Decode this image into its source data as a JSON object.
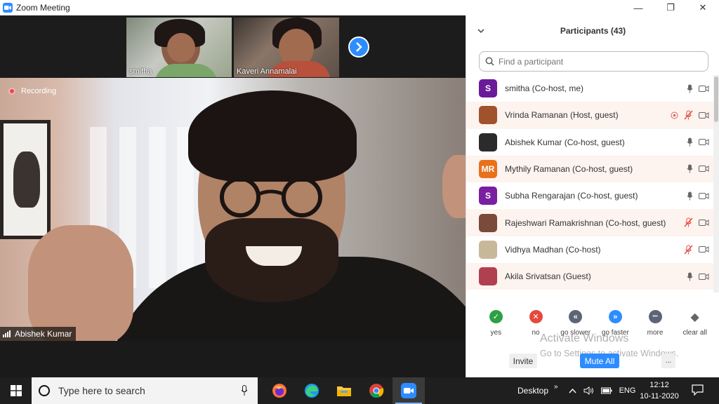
{
  "window": {
    "title": "Zoom Meeting",
    "minimize": "—",
    "maximize": "❐",
    "close": "✕"
  },
  "meeting": {
    "recording_label": "Recording",
    "active_speaker": "Abishek Kumar",
    "thumbnails": [
      {
        "name": "smitha"
      },
      {
        "name": "Kaveri Annamalai"
      }
    ]
  },
  "panel": {
    "title": "Participants (43)",
    "search_placeholder": "Find a participant",
    "participants": [
      {
        "name": "smitha (Co-host, me)",
        "avatar_text": "S",
        "avatar_color": "#6a1b9a",
        "mic": "on",
        "highlight": false
      },
      {
        "name": "Vrinda Ramanan (Host, guest)",
        "avatar_text": "",
        "avatar_color": "#a0522d",
        "mic": "muted",
        "highlight": true,
        "recording": true
      },
      {
        "name": "Abishek Kumar (Co-host, guest)",
        "avatar_text": "",
        "avatar_color": "#2b2b2b",
        "mic": "on",
        "highlight": false
      },
      {
        "name": "Mythily Ramanan (Co-host, guest)",
        "avatar_text": "MR",
        "avatar_color": "#e8711c",
        "mic": "on",
        "highlight": true
      },
      {
        "name": "Subha Rengarajan (Co-host, guest)",
        "avatar_text": "S",
        "avatar_color": "#7b1fa2",
        "mic": "on",
        "highlight": false
      },
      {
        "name": "Rajeshwari Ramakrishnan (Co-host, guest)",
        "avatar_text": "",
        "avatar_color": "#7a4a3a",
        "mic": "muted",
        "highlight": true
      },
      {
        "name": "Vidhya Madhan (Co-host)",
        "avatar_text": "",
        "avatar_color": "#c8b89a",
        "mic": "muted",
        "highlight": false
      },
      {
        "name": "Akila Srivatsan (Guest)",
        "avatar_text": "",
        "avatar_color": "#b04050",
        "mic": "on",
        "highlight": true
      }
    ],
    "reactions": [
      {
        "label": "yes",
        "color": "#2ea043",
        "glyph": "✓"
      },
      {
        "label": "no",
        "color": "#e5483d",
        "glyph": "✕"
      },
      {
        "label": "go slower",
        "color": "#5b6576",
        "glyph": "«"
      },
      {
        "label": "go faster",
        "color": "#2d8cff",
        "glyph": "»"
      },
      {
        "label": "more",
        "color": "#5b6576",
        "glyph": "•••"
      },
      {
        "label": "clear all",
        "color": "#666666",
        "glyph": "◆"
      }
    ],
    "invite_label": "Invite",
    "mute_all_label": "Mute All",
    "more_label": "...",
    "watermark_title": "Activate Windows",
    "watermark_sub": "Go to Settings to activate Windows."
  },
  "taskbar": {
    "search_placeholder": "Type here to search",
    "desktop_label": "Desktop",
    "chevron": "»",
    "language": "ENG",
    "time": "12:12",
    "date": "10-11-2020",
    "apps": [
      "firefox",
      "edge",
      "file-explorer",
      "chrome",
      "zoom"
    ]
  },
  "colors": {
    "accent": "#2d8cff",
    "muted_red": "#e5483d",
    "highlight_row": "#fdf3ef"
  }
}
